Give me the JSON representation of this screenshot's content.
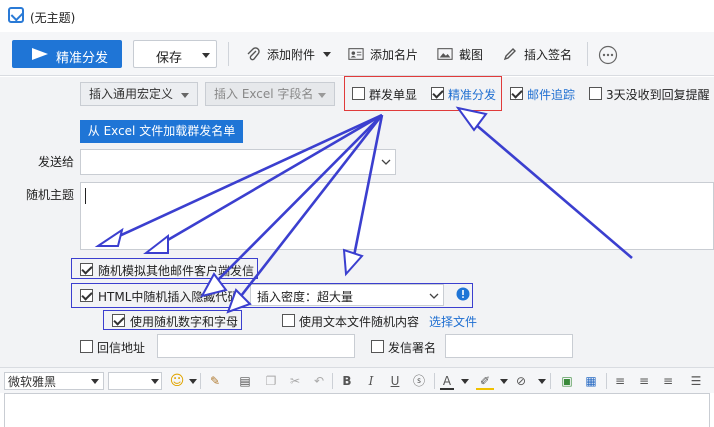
{
  "window": {
    "title": "(无主题)"
  },
  "toolbar": {
    "send_label": "精准分发",
    "save_label": "保存",
    "attach_label": "添加附件",
    "card_label": "添加名片",
    "screenshot_label": "截图",
    "signature_label": "插入签名"
  },
  "options": {
    "insert_macro": "插入通用宏定义",
    "insert_excel_field": "插入 Excel 字段名",
    "mass_single": "群发单显",
    "precise_send": "精准分发",
    "mail_tracking": "邮件追踪",
    "no_reply_reminder": "3天没收到回复提醒",
    "mass_single_checked": false,
    "precise_send_checked": true,
    "mail_tracking_checked": true,
    "no_reply_reminder_checked": false
  },
  "form": {
    "load_recipients": "从 Excel 文件加载群发名单",
    "send_to_label": "发送给",
    "random_subject_label": "随机主题",
    "simulate_client": "随机模拟其他邮件客户端发信",
    "html_random_code": "HTML中随机插入隐藏代码",
    "density_value": "插入密度：超大量",
    "random_alnum": "使用随机数字和字母",
    "random_text_file": "使用文本文件随机内容",
    "select_file": "选择文件",
    "reply_address": "回信地址",
    "sender_signature": "发信署名",
    "simulate_client_checked": true,
    "html_random_code_checked": true,
    "random_alnum_checked": true,
    "random_text_file_checked": false,
    "reply_address_checked": false,
    "sender_signature_checked": false
  },
  "editor": {
    "font_name": "微软雅黑",
    "bold": "B",
    "italic": "I",
    "underline": "U",
    "font_color": "A"
  },
  "colors": {
    "accent": "#1f75d6",
    "annotation_red": "#e03a3a",
    "annotation_blue": "#3b3fcf"
  }
}
